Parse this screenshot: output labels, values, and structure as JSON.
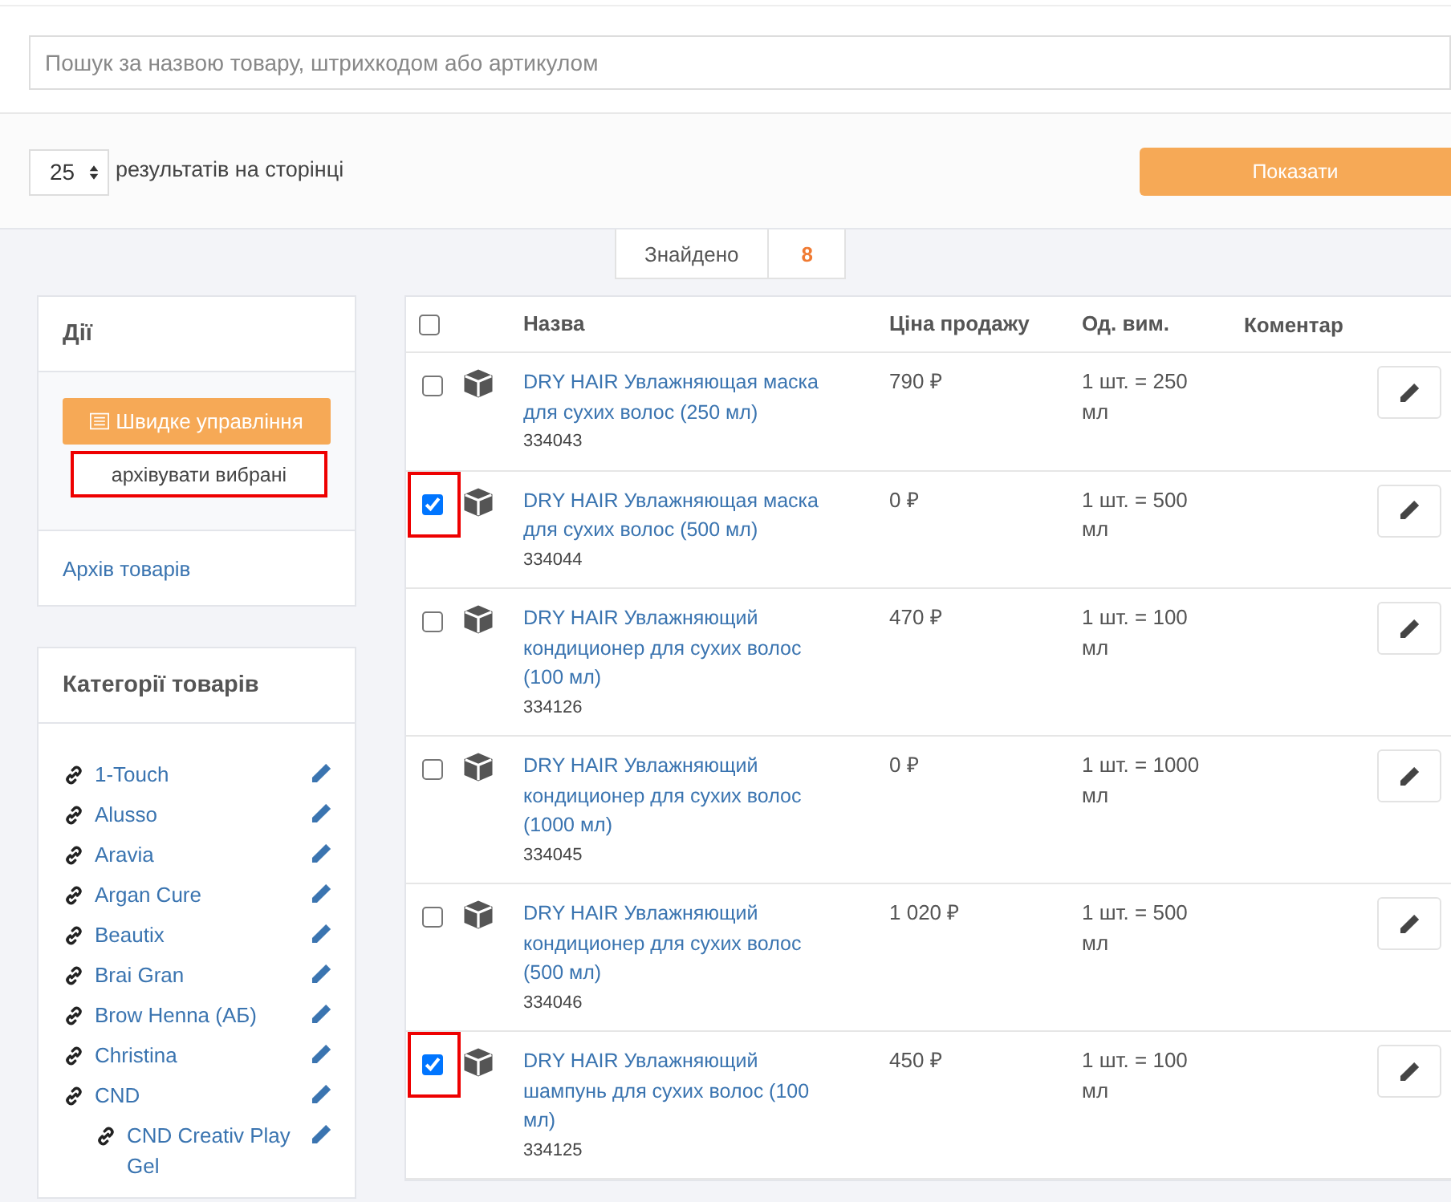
{
  "search": {
    "placeholder": "Пошук за назвою товару, штрихкодом або артикулом"
  },
  "per_page": {
    "value": "25",
    "label": "результатів на сторінці"
  },
  "show_button": "Показати",
  "found": {
    "label": "Знайдено",
    "count": "8"
  },
  "actions": {
    "title": "Дії",
    "quick_button": "Швидке управління",
    "archive_button": {
      "label": "архівувати вибрані",
      "highlighted": true
    },
    "archive_link": "Архів товарів"
  },
  "categories": {
    "title": "Категорії товарів",
    "items": [
      {
        "name": "1-Touch"
      },
      {
        "name": "Alusso"
      },
      {
        "name": "Aravia"
      },
      {
        "name": "Argan Cure"
      },
      {
        "name": "Beautix"
      },
      {
        "name": "Brai Gran"
      },
      {
        "name": "Brow Henna (АБ)"
      },
      {
        "name": "Christina"
      },
      {
        "name": "CND",
        "children": [
          {
            "name": "CND Creativ Play Gel"
          }
        ]
      }
    ]
  },
  "table": {
    "columns": [
      "Назва",
      "Ціна продажу",
      "Од. вим.",
      "Коментар"
    ],
    "select_all": false,
    "rows": [
      {
        "checked": false,
        "highlighted": false,
        "name": "DRY HAIR Увлажняющая маска для сухих волос (250 мл)",
        "code": "334043",
        "price": "790 ₽",
        "unit": "1 шт. = 250 мл"
      },
      {
        "checked": true,
        "highlighted": true,
        "name": "DRY HAIR Увлажняющая маска для сухих волос (500 мл)",
        "code": "334044",
        "price": "0 ₽",
        "unit": "1 шт. = 500 мл"
      },
      {
        "checked": false,
        "highlighted": false,
        "name": "DRY HAIR Увлажняющий кондиционер для сухих волос (100 мл)",
        "code": "334126",
        "price": "470 ₽",
        "unit": "1 шт. = 100 мл"
      },
      {
        "checked": false,
        "highlighted": false,
        "name": "DRY HAIR Увлажняющий кондиционер для сухих волос (1000 мл)",
        "code": "334045",
        "price": "0 ₽",
        "unit": "1 шт. = 1000 мл"
      },
      {
        "checked": false,
        "highlighted": false,
        "name": "DRY HAIR Увлажняющий кондиционер для сухих волос (500 мл)",
        "code": "334046",
        "price": "1 020 ₽",
        "unit": "1 шт. = 500 мл"
      },
      {
        "checked": true,
        "highlighted": true,
        "name": "DRY HAIR Увлажняющий шампунь для сухих волос (100 мл)",
        "code": "334125",
        "price": "450 ₽",
        "unit": "1 шт. = 100 мл"
      }
    ]
  }
}
